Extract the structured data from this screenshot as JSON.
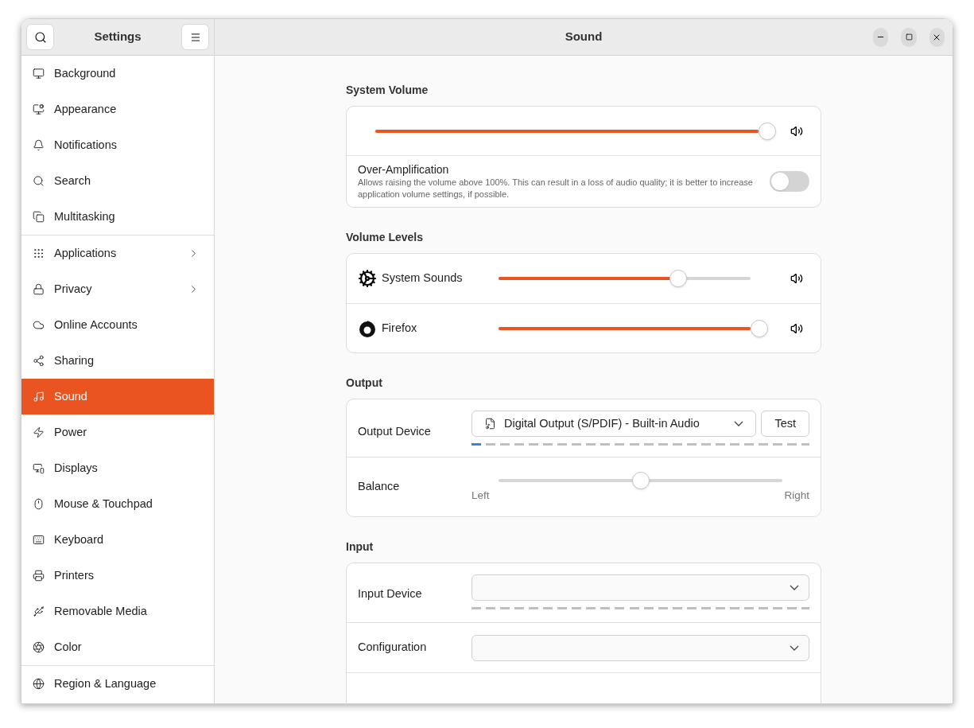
{
  "window": {
    "sidebar_title": "Settings",
    "title": "Sound"
  },
  "sidebar": {
    "groups": [
      [
        {
          "label": "Background",
          "selected": false,
          "submenu": false
        },
        {
          "label": "Appearance",
          "selected": false,
          "submenu": false
        },
        {
          "label": "Notifications",
          "selected": false,
          "submenu": false
        },
        {
          "label": "Search",
          "selected": false,
          "submenu": false
        },
        {
          "label": "Multitasking",
          "selected": false,
          "submenu": false
        }
      ],
      [
        {
          "label": "Applications",
          "selected": false,
          "submenu": true
        },
        {
          "label": "Privacy",
          "selected": false,
          "submenu": true
        },
        {
          "label": "Online Accounts",
          "selected": false,
          "submenu": false
        },
        {
          "label": "Sharing",
          "selected": false,
          "submenu": false
        },
        {
          "label": "Sound",
          "selected": true,
          "submenu": false
        },
        {
          "label": "Power",
          "selected": false,
          "submenu": false
        },
        {
          "label": "Displays",
          "selected": false,
          "submenu": false
        },
        {
          "label": "Mouse & Touchpad",
          "selected": false,
          "submenu": false
        },
        {
          "label": "Keyboard",
          "selected": false,
          "submenu": false
        },
        {
          "label": "Printers",
          "selected": false,
          "submenu": false
        },
        {
          "label": "Removable Media",
          "selected": false,
          "submenu": false
        },
        {
          "label": "Color",
          "selected": false,
          "submenu": false
        }
      ],
      [
        {
          "label": "Region & Language",
          "selected": false,
          "submenu": false
        }
      ]
    ]
  },
  "system_volume": {
    "heading": "System Volume",
    "level": 1,
    "over_amplification": {
      "title": "Over-Amplification",
      "description": "Allows raising the volume above 100%. This can result in a loss of audio quality; it is better to increase application volume settings, if possible.",
      "on": false
    }
  },
  "volume_levels": {
    "heading": "Volume Levels",
    "items": [
      {
        "name": "System Sounds",
        "level": 0.7
      },
      {
        "name": "Firefox",
        "level": 1
      }
    ]
  },
  "output": {
    "heading": "Output",
    "device_label": "Output Device",
    "device_value": "Digital Output (S/PDIF) - Built-in Audio",
    "test_button": "Test",
    "meter": {
      "level": 0.04
    },
    "balance_label": "Balance",
    "balance": {
      "level": 0.5
    },
    "left": "Left",
    "right": "Right"
  },
  "input": {
    "heading": "Input",
    "device_label": "Input Device",
    "configuration_label": "Configuration"
  }
}
